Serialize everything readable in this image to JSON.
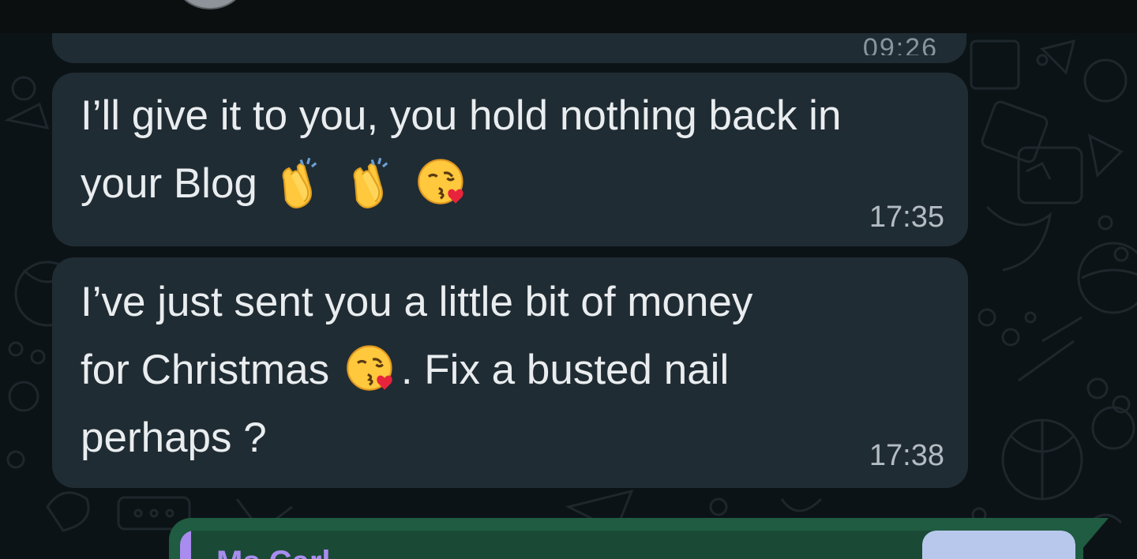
{
  "chat": {
    "contact_name": "",
    "previous_message": {
      "time": "09:26"
    },
    "messages": [
      {
        "line1": "I’ll give it to you, you hold nothing back in",
        "line2_text": "your Blog",
        "line2_emojis": [
          "clapping-hands",
          "clapping-hands",
          "face-blowing-kiss"
        ],
        "time": "17:35"
      },
      {
        "line1": "I’ve just sent you a little bit of money",
        "line2_pre": "for Christmas",
        "line2_emoji": "face-blowing-kiss",
        "line2_post": ". Fix a busted nail",
        "line3": "perhaps ?",
        "time": "17:38"
      }
    ],
    "outgoing_reply": {
      "quoted_author": "Ms Carl...",
      "accent_color": "#a98cf0"
    }
  },
  "colors": {
    "incoming_bubble": "#202c33",
    "outgoing_bubble": "#1f5c41",
    "background": "#0c1317",
    "text": "#e9edef",
    "timestamp": "#b3bcc2"
  }
}
